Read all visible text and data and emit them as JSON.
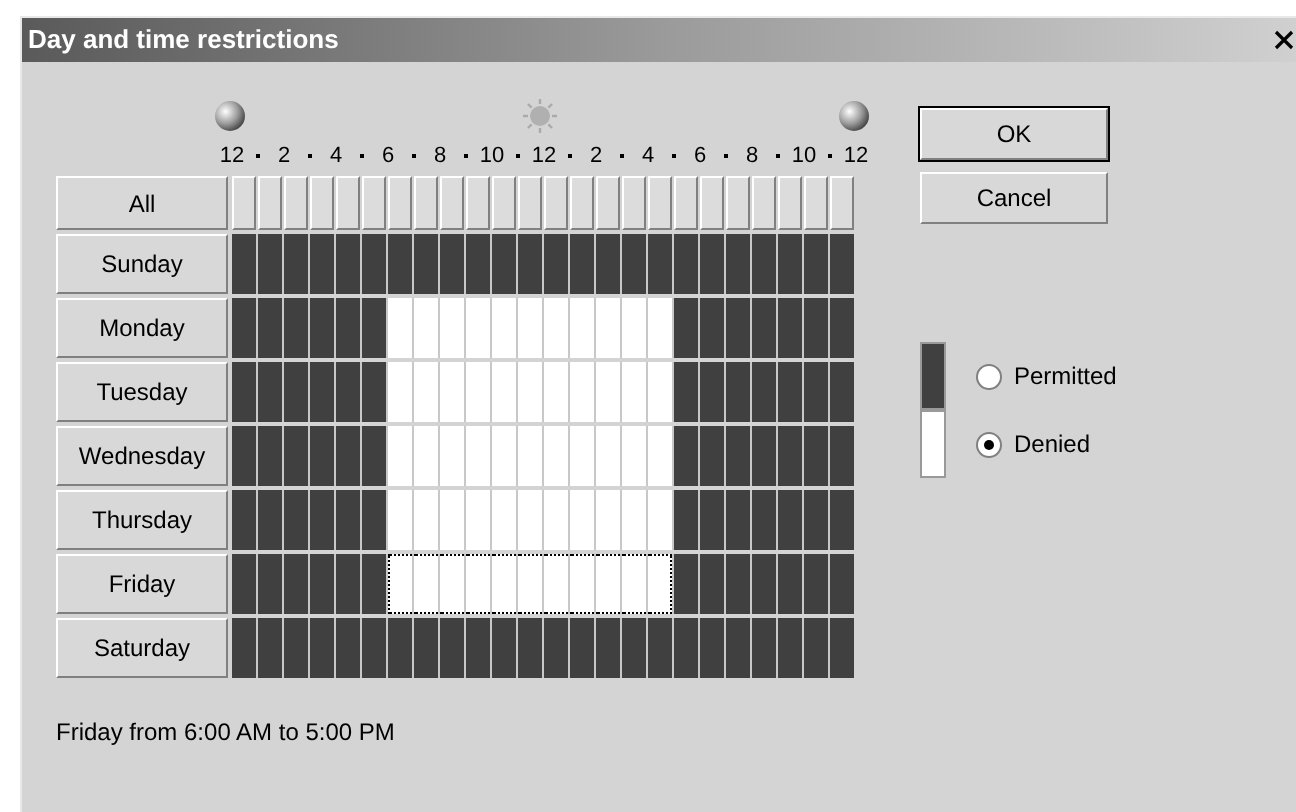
{
  "window": {
    "title": "Day and time restrictions"
  },
  "hour_labels": [
    "12",
    "2",
    "4",
    "6",
    "8",
    "10",
    "12",
    "2",
    "4",
    "6",
    "8",
    "10",
    "12"
  ],
  "all_label": "All",
  "days": [
    {
      "name": "Sunday",
      "permitted": [
        true,
        true,
        true,
        true,
        true,
        true,
        true,
        true,
        true,
        true,
        true,
        true,
        true,
        true,
        true,
        true,
        true,
        true,
        true,
        true,
        true,
        true,
        true,
        true
      ],
      "selected": [
        false,
        false,
        false,
        false,
        false,
        false,
        false,
        false,
        false,
        false,
        false,
        false,
        false,
        false,
        false,
        false,
        false,
        false,
        false,
        false,
        false,
        false,
        false,
        false
      ]
    },
    {
      "name": "Monday",
      "permitted": [
        true,
        true,
        true,
        true,
        true,
        true,
        false,
        false,
        false,
        false,
        false,
        false,
        false,
        false,
        false,
        false,
        false,
        true,
        true,
        true,
        true,
        true,
        true,
        true
      ],
      "selected": [
        false,
        false,
        false,
        false,
        false,
        false,
        false,
        false,
        false,
        false,
        false,
        false,
        false,
        false,
        false,
        false,
        false,
        false,
        false,
        false,
        false,
        false,
        false,
        false
      ]
    },
    {
      "name": "Tuesday",
      "permitted": [
        true,
        true,
        true,
        true,
        true,
        true,
        false,
        false,
        false,
        false,
        false,
        false,
        false,
        false,
        false,
        false,
        false,
        true,
        true,
        true,
        true,
        true,
        true,
        true
      ],
      "selected": [
        false,
        false,
        false,
        false,
        false,
        false,
        false,
        false,
        false,
        false,
        false,
        false,
        false,
        false,
        false,
        false,
        false,
        false,
        false,
        false,
        false,
        false,
        false,
        false
      ]
    },
    {
      "name": "Wednesday",
      "permitted": [
        true,
        true,
        true,
        true,
        true,
        true,
        false,
        false,
        false,
        false,
        false,
        false,
        false,
        false,
        false,
        false,
        false,
        true,
        true,
        true,
        true,
        true,
        true,
        true
      ],
      "selected": [
        false,
        false,
        false,
        false,
        false,
        false,
        false,
        false,
        false,
        false,
        false,
        false,
        false,
        false,
        false,
        false,
        false,
        false,
        false,
        false,
        false,
        false,
        false,
        false
      ]
    },
    {
      "name": "Thursday",
      "permitted": [
        true,
        true,
        true,
        true,
        true,
        true,
        false,
        false,
        false,
        false,
        false,
        false,
        false,
        false,
        false,
        false,
        false,
        true,
        true,
        true,
        true,
        true,
        true,
        true
      ],
      "selected": [
        false,
        false,
        false,
        false,
        false,
        false,
        false,
        false,
        false,
        false,
        false,
        false,
        false,
        false,
        false,
        false,
        false,
        false,
        false,
        false,
        false,
        false,
        false,
        false
      ]
    },
    {
      "name": "Friday",
      "permitted": [
        true,
        true,
        true,
        true,
        true,
        true,
        false,
        false,
        false,
        false,
        false,
        false,
        false,
        false,
        false,
        false,
        false,
        true,
        true,
        true,
        true,
        true,
        true,
        true
      ],
      "selected": [
        false,
        false,
        false,
        false,
        false,
        false,
        true,
        true,
        true,
        true,
        true,
        true,
        true,
        true,
        true,
        true,
        true,
        false,
        false,
        false,
        false,
        false,
        false,
        false
      ]
    },
    {
      "name": "Saturday",
      "permitted": [
        true,
        true,
        true,
        true,
        true,
        true,
        true,
        true,
        true,
        true,
        true,
        true,
        true,
        true,
        true,
        true,
        true,
        true,
        true,
        true,
        true,
        true,
        true,
        true
      ],
      "selected": [
        false,
        false,
        false,
        false,
        false,
        false,
        false,
        false,
        false,
        false,
        false,
        false,
        false,
        false,
        false,
        false,
        false,
        false,
        false,
        false,
        false,
        false,
        false,
        false
      ]
    }
  ],
  "buttons": [
    {
      "label": "OK",
      "default": true
    },
    {
      "label": "Cancel",
      "default": false
    }
  ],
  "options": [
    {
      "label": "Permitted",
      "kind": "permitted",
      "selected": false
    },
    {
      "label": "Denied",
      "kind": "denied",
      "selected": true
    }
  ],
  "status": "Friday from 6:00 AM to 5:00 PM"
}
